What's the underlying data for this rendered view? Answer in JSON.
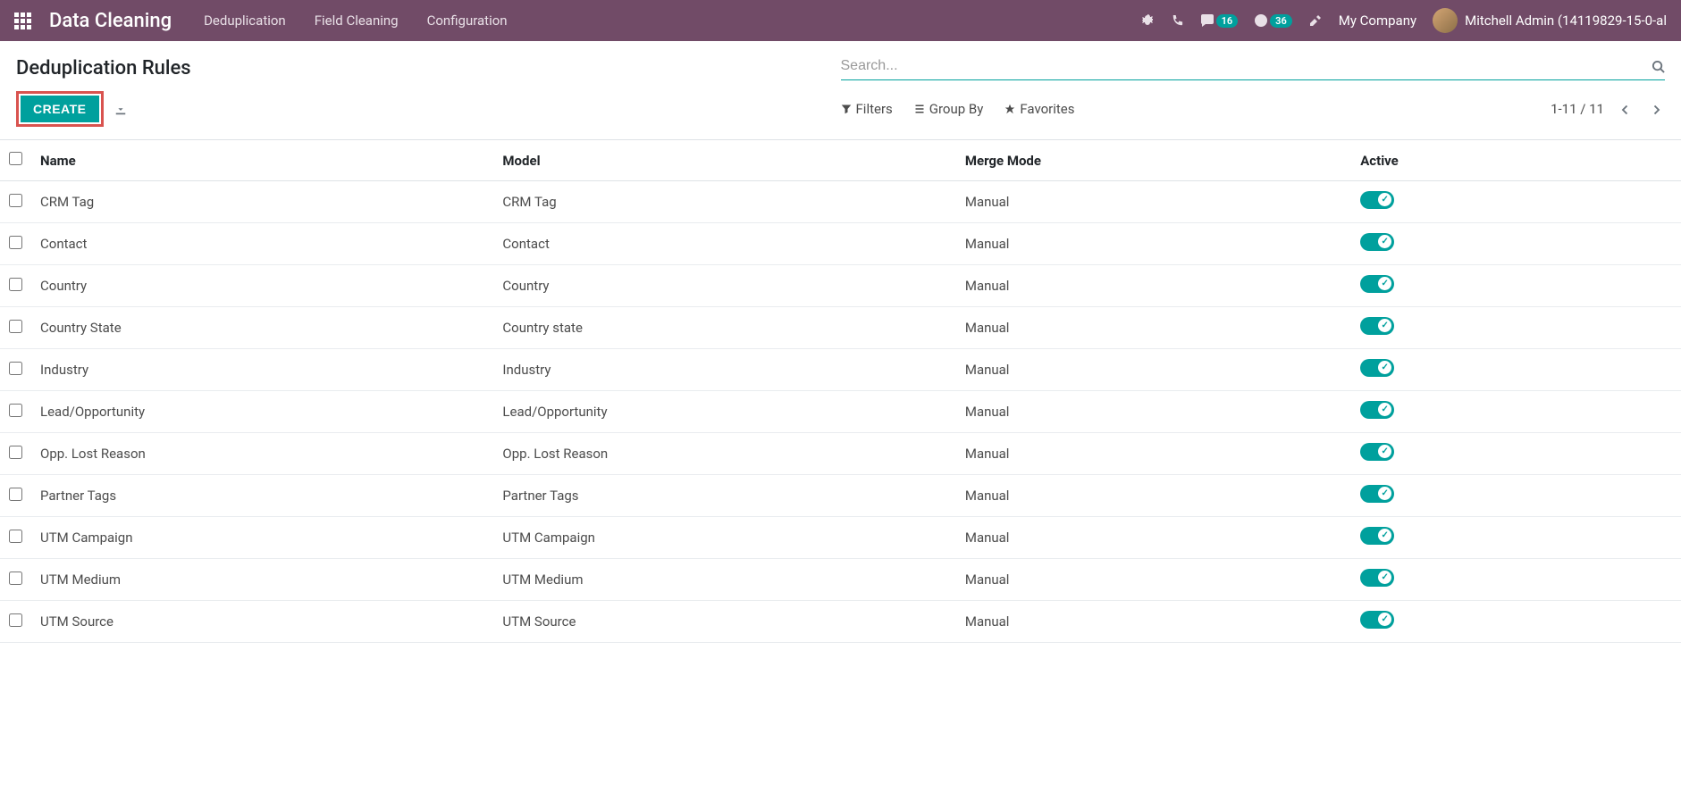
{
  "header": {
    "brand": "Data Cleaning",
    "menu": [
      "Deduplication",
      "Field Cleaning",
      "Configuration"
    ],
    "messages_badge": "16",
    "activities_badge": "36",
    "company": "My Company",
    "user": "Mitchell Admin (14119829-15-0-al"
  },
  "control": {
    "breadcrumb": "Deduplication Rules",
    "search_placeholder": "Search...",
    "create_label": "CREATE",
    "filters_label": "Filters",
    "groupby_label": "Group By",
    "favorites_label": "Favorites",
    "pager": "1-11 / 11"
  },
  "table": {
    "columns": {
      "name": "Name",
      "model": "Model",
      "merge": "Merge Mode",
      "active": "Active"
    },
    "rows": [
      {
        "name": "CRM Tag",
        "model": "CRM Tag",
        "merge": "Manual",
        "active": true
      },
      {
        "name": "Contact",
        "model": "Contact",
        "merge": "Manual",
        "active": true
      },
      {
        "name": "Country",
        "model": "Country",
        "merge": "Manual",
        "active": true
      },
      {
        "name": "Country State",
        "model": "Country state",
        "merge": "Manual",
        "active": true
      },
      {
        "name": "Industry",
        "model": "Industry",
        "merge": "Manual",
        "active": true
      },
      {
        "name": "Lead/Opportunity",
        "model": "Lead/Opportunity",
        "merge": "Manual",
        "active": true
      },
      {
        "name": "Opp. Lost Reason",
        "model": "Opp. Lost Reason",
        "merge": "Manual",
        "active": true
      },
      {
        "name": "Partner Tags",
        "model": "Partner Tags",
        "merge": "Manual",
        "active": true
      },
      {
        "name": "UTM Campaign",
        "model": "UTM Campaign",
        "merge": "Manual",
        "active": true
      },
      {
        "name": "UTM Medium",
        "model": "UTM Medium",
        "merge": "Manual",
        "active": true
      },
      {
        "name": "UTM Source",
        "model": "UTM Source",
        "merge": "Manual",
        "active": true
      }
    ]
  }
}
